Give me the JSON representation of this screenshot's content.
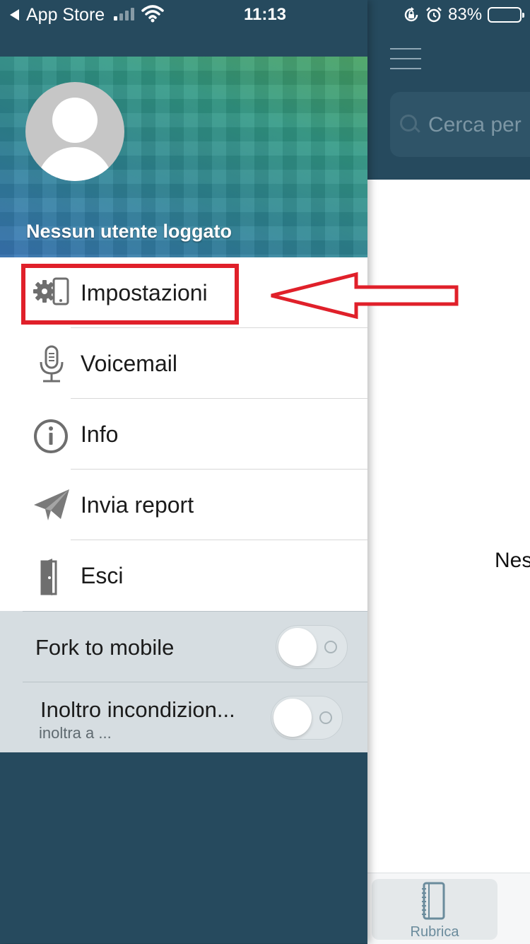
{
  "status_bar": {
    "back_app": "App Store",
    "time": "11:13",
    "battery_percent": "83%",
    "battery_level": 0.83,
    "signal_bars_active": 1,
    "icons": [
      "back-triangle-icon",
      "signal-icon",
      "wifi-icon",
      "rotation-lock-icon",
      "alarm-icon",
      "battery-icon"
    ]
  },
  "drawer": {
    "user_label": "Nessun utente loggato",
    "menu_items": [
      {
        "label": "Impostazioni",
        "icon": "gear-phone-icon"
      },
      {
        "label": "Voicemail",
        "icon": "microphone-icon"
      },
      {
        "label": "Info",
        "icon": "info-icon"
      },
      {
        "label": "Invia report",
        "icon": "paper-plane-icon"
      },
      {
        "label": "Esci",
        "icon": "door-icon"
      }
    ],
    "toggles": [
      {
        "label": "Fork to mobile",
        "sublabel": "",
        "on": false
      },
      {
        "label": "Inoltro incondizion...",
        "sublabel": "inoltra a ...",
        "on": false
      }
    ]
  },
  "main": {
    "search_placeholder": "Cerca per",
    "empty_text": "Nes",
    "tabs": [
      {
        "label": "Rubrica",
        "icon": "address-book-icon",
        "active": true
      }
    ]
  },
  "annotation": {
    "highlight_target": "Impostazioni",
    "color": "#e0202a"
  },
  "colors": {
    "dark_teal": "#264a5e",
    "toggle_bg": "#d6dde1",
    "icon_gray": "#6e6e6e",
    "tab_accent": "#6a8b9c"
  }
}
